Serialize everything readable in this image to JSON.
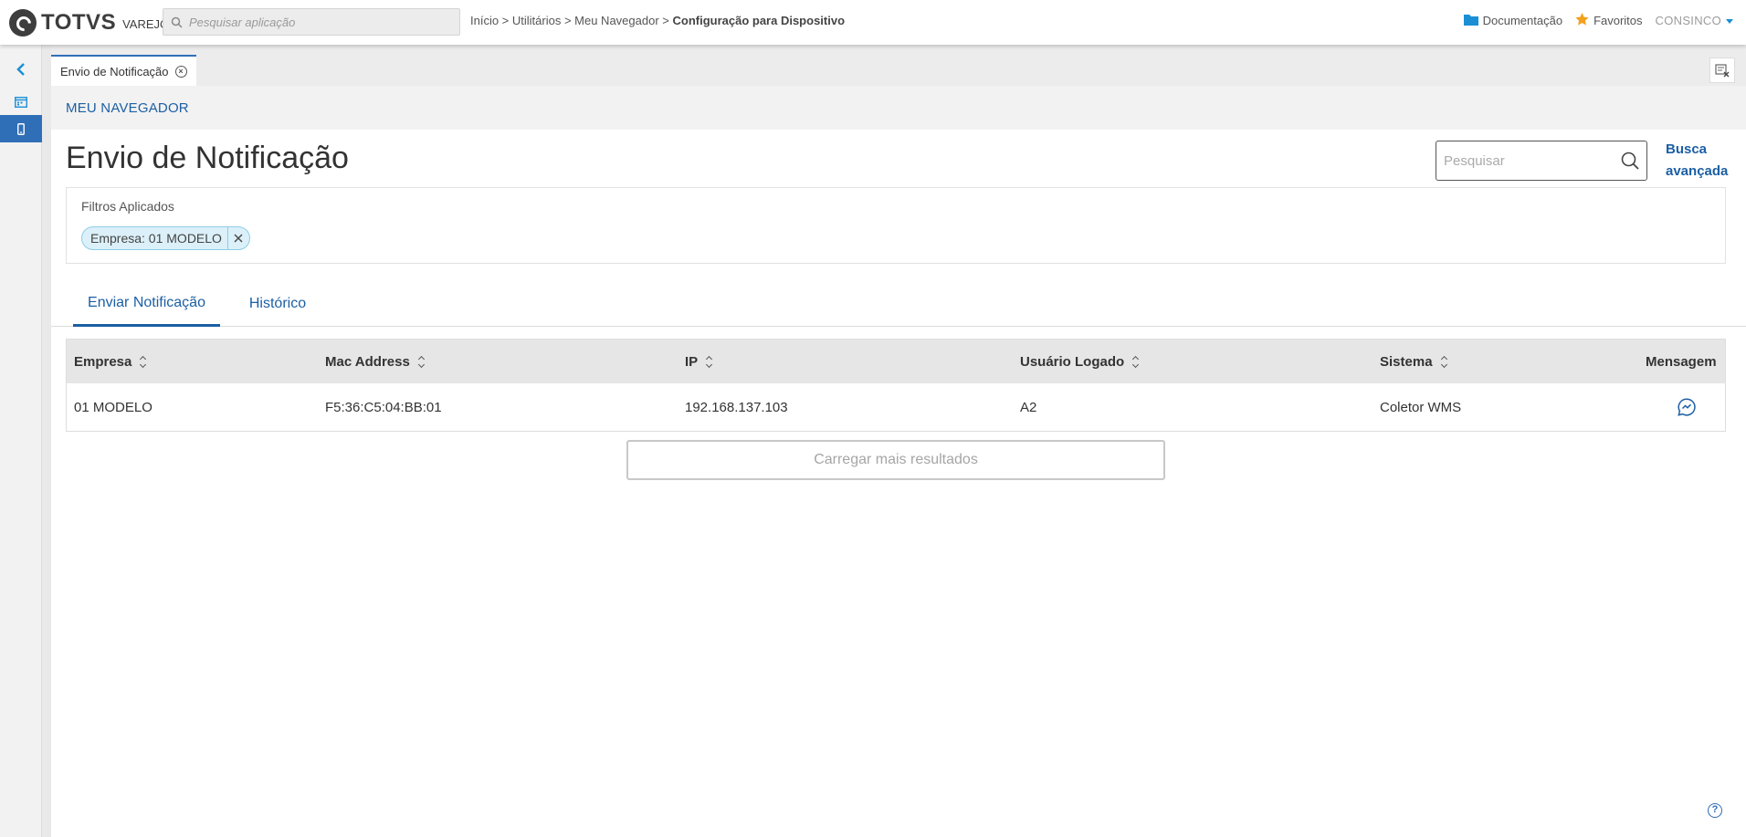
{
  "brand": {
    "name": "TOTVS",
    "product": "VAREJO"
  },
  "app_search": {
    "placeholder": "Pesquisar aplicação"
  },
  "breadcrumb": {
    "path": "Início > Utilitários > Meu Navegador > ",
    "current": "Configuração para Dispositivo"
  },
  "header_links": {
    "docs": "Documentação",
    "favorites": "Favoritos",
    "user": "CONSINCO"
  },
  "colors": {
    "accent": "#2f6fb8",
    "link": "#1c5fa3",
    "chip_bg": "#dcf0f9",
    "star": "#f2a11e"
  },
  "rail": {
    "items": [
      "chevron-left-icon",
      "calendar-icon",
      "mobile-device-icon"
    ],
    "active_index": 2
  },
  "open_tab": {
    "label": "Envio de Notificação"
  },
  "section": {
    "label": "MEU NAVEGADOR"
  },
  "page": {
    "title": "Envio de Notificação"
  },
  "search": {
    "placeholder": "Pesquisar"
  },
  "advanced_search": {
    "line1": "Busca",
    "line2": "avançada"
  },
  "filters": {
    "label": "Filtros Aplicados",
    "chips": [
      "Empresa: 01 MODELO"
    ]
  },
  "tabs": [
    {
      "label": "Enviar Notificação",
      "active": true
    },
    {
      "label": "Histórico",
      "active": false
    }
  ],
  "table": {
    "columns": [
      "Empresa",
      "Mac Address",
      "IP",
      "Usuário Logado",
      "Sistema",
      "Mensagem"
    ],
    "rows": [
      [
        "01 MODELO",
        "F5:36:C5:04:BB:01",
        "192.168.137.103",
        "A2",
        "Coletor WMS",
        "message-icon"
      ]
    ]
  },
  "load_more": {
    "label": "Carregar mais resultados"
  },
  "help": {
    "label": "?"
  }
}
